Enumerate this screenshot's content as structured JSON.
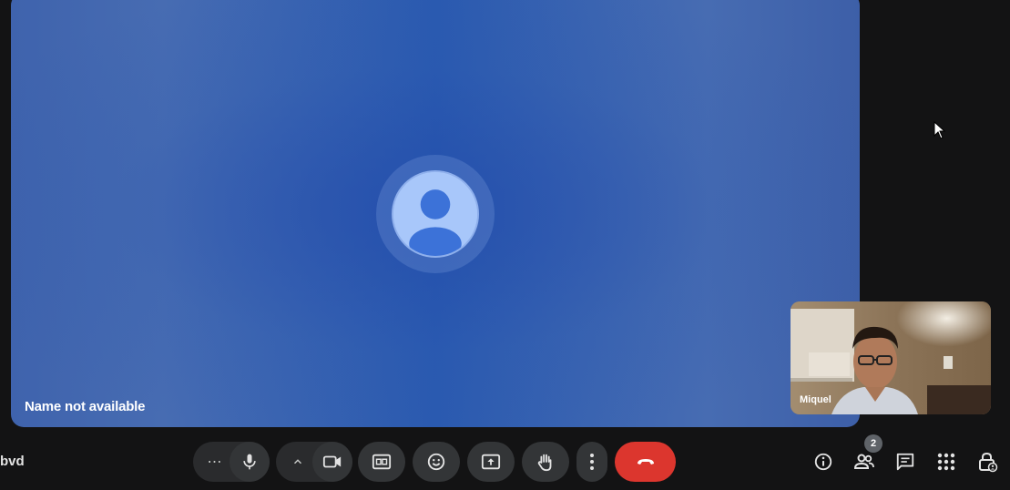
{
  "main_tile": {
    "participant_name": "Name not available"
  },
  "self_view": {
    "participant_name": "Miquel"
  },
  "bottom_bar": {
    "meeting_code": "bvd",
    "more_options_label": "⋯",
    "chevron_label": "^"
  },
  "people": {
    "count": "2"
  },
  "icons": {
    "more_options": "more-horizontal-icon",
    "microphone": "microphone-icon",
    "camera_options": "chevron-up-icon",
    "camera": "videocam-icon",
    "captions": "closed-caption-icon",
    "reactions": "emoji-icon",
    "present": "present-screen-icon",
    "raise_hand": "raise-hand-icon",
    "more_vert": "more-vertical-icon",
    "leave_call": "call-end-icon",
    "info": "info-icon",
    "people": "people-icon",
    "chat": "chat-icon",
    "activities": "apps-grid-icon",
    "host_controls": "lock-person-icon"
  },
  "colors": {
    "background": "#131314",
    "tile_blue": "#2a5ab0",
    "avatar": "#a8c7fa",
    "button": "#333537",
    "end_call": "#dc362e"
  }
}
